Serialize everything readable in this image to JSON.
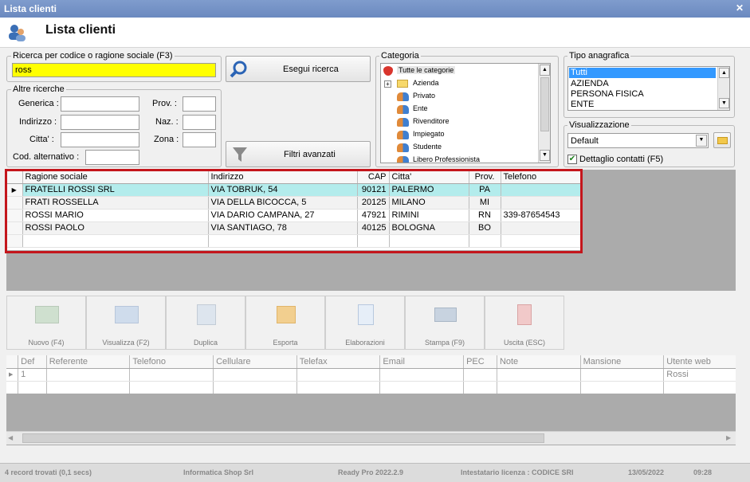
{
  "window": {
    "title": "Lista clienti",
    "close_glyph": "✕"
  },
  "header": {
    "title": "Lista clienti",
    "icon": "users-icon"
  },
  "search": {
    "label": "Ricerca per codice o ragione sociale (F3)",
    "value": "ross",
    "run_label": "Esegui ricerca",
    "adv_label": "Filtri avanzati"
  },
  "altre": {
    "label": "Altre ricerche",
    "generica": "Generica :",
    "indirizzo": "Indirizzo :",
    "citta": "Citta' :",
    "codalt": "Cod. alternativo :",
    "prov": "Prov. :",
    "naz": "Naz. :",
    "zona": "Zona :"
  },
  "categoria": {
    "label": "Categoria",
    "items": [
      "Tutte le categorie",
      "Azienda",
      "Privato",
      "Ente",
      "Rivenditore",
      "Impiegato",
      "Studente",
      "Libero Professionista"
    ]
  },
  "tipo": {
    "label": "Tipo anagrafica",
    "items": [
      "Tutti",
      "AZIENDA",
      "PERSONA FISICA",
      "ENTE"
    ]
  },
  "visual": {
    "label": "Visualizzazione",
    "value": "Default",
    "dettaglio": "Dettaglio contatti (F5)"
  },
  "grid": {
    "columns": [
      "Ragione sociale",
      "Indirizzo",
      "CAP",
      "Citta'",
      "Prov.",
      "Telefono"
    ],
    "rows": [
      {
        "rs": "FRATELLI ROSSI SRL",
        "ind": "VIA TOBRUK, 54",
        "cap": "90121",
        "citta": "PALERMO",
        "prov": "PA",
        "tel": ""
      },
      {
        "rs": "FRATI ROSSELLA",
        "ind": "VIA DELLA BICOCCA, 5",
        "cap": "20125",
        "citta": "MILANO",
        "prov": "MI",
        "tel": ""
      },
      {
        "rs": "ROSSI MARIO",
        "ind": "VIA DARIO CAMPANA, 27",
        "cap": "47921",
        "citta": "RIMINI",
        "prov": "RN",
        "tel": "339-87654543"
      },
      {
        "rs": "ROSSI PAOLO",
        "ind": "VIA SANTIAGO, 78",
        "cap": "40125",
        "citta": "BOLOGNA",
        "prov": "BO",
        "tel": ""
      }
    ]
  },
  "toolbar": {
    "nuovo": "Nuovo (F4)",
    "visualizza": "Visualizza (F2)",
    "duplica": "Duplica",
    "esporta": "Esporta",
    "elaborazioni": "Elaborazioni",
    "stampa": "Stampa (F9)",
    "uscita": "Uscita (ESC)"
  },
  "contacts": {
    "columns": [
      "Def",
      "Referente",
      "Telefono",
      "Cellulare",
      "Telefax",
      "Email",
      "PEC",
      "Note",
      "Mansione",
      "Utente web"
    ],
    "row": {
      "def": "1",
      "utente": "Rossi"
    }
  },
  "status": {
    "records": "4 record trovati (0,1 secs)",
    "company": "Informatica Shop Srl",
    "product": "Ready Pro 2022.2.9",
    "license": "Intestatario licenza : CODICE SRI",
    "date": "13/05/2022",
    "time": "09:28"
  },
  "colors": {
    "highlight": "#ffff00",
    "selected_row": "#b3ecec",
    "select_blue": "#3399ff",
    "red_frame": "#c4161c"
  }
}
